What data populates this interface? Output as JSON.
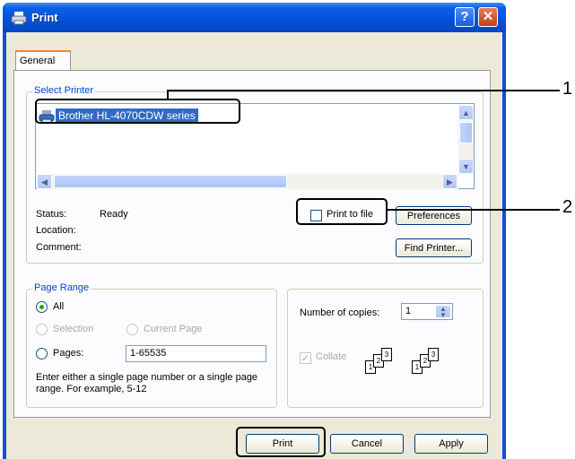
{
  "window": {
    "title": "Print",
    "help_label": "?",
    "close_label": "✕"
  },
  "tabs": {
    "general": "General"
  },
  "select_printer": {
    "label": "Select Printer",
    "selected_printer": "Brother HL-4070CDW series",
    "status_label": "Status:",
    "status_value": "Ready",
    "location_label": "Location:",
    "comment_label": "Comment:",
    "print_to_file_label": "Print to file",
    "preferences_button": "Preferences",
    "find_printer_button": "Find Printer..."
  },
  "page_range": {
    "label": "Page Range",
    "all_label": "All",
    "selection_label": "Selection",
    "current_page_label": "Current Page",
    "pages_label": "Pages:",
    "pages_value": "1-65535",
    "hint": "Enter either a single page number or a single page range.  For example, 5-12"
  },
  "copies": {
    "number_label": "Number of copies:",
    "number_value": "1",
    "collate_label": "Collate",
    "page_numbers": [
      "1",
      "2",
      "3",
      "1",
      "2",
      "3"
    ]
  },
  "buttons": {
    "print": "Print",
    "cancel": "Cancel",
    "apply": "Apply"
  },
  "callouts": [
    "1",
    "2"
  ]
}
